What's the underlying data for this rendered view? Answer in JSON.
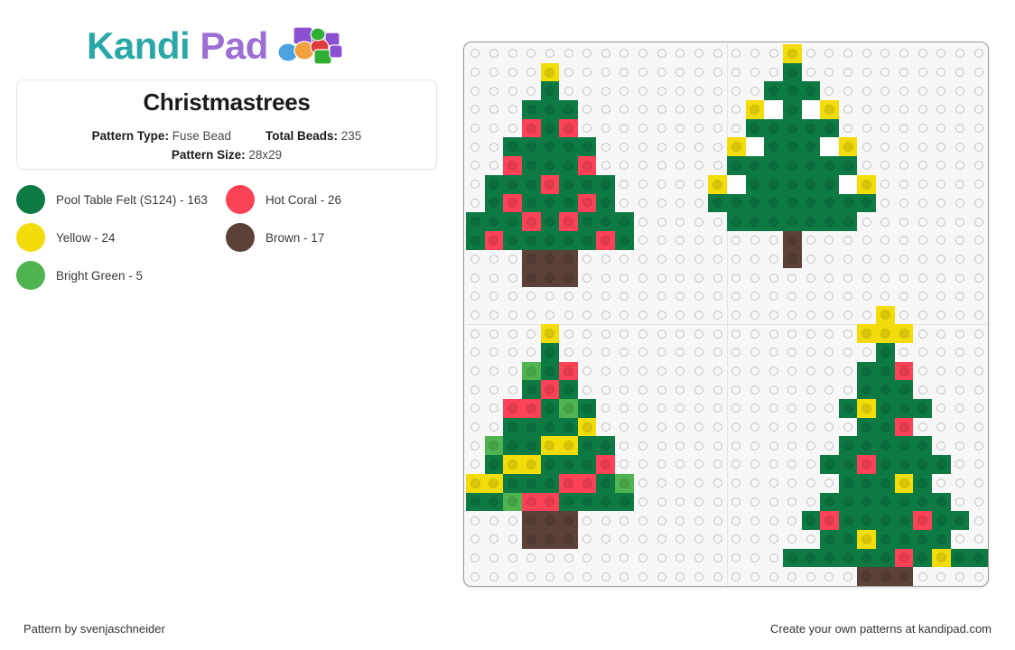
{
  "brand": {
    "name_part1": "Kandi",
    "name_part2": "Pad",
    "logo_icon": "kandi-beads-icon",
    "color_teal": "#2aa8a8",
    "color_purple": "#9b6fd4"
  },
  "card": {
    "title": "Christmastrees",
    "pattern_type_label": "Pattern Type:",
    "pattern_type_value": "Fuse Bead",
    "total_beads_label": "Total Beads:",
    "total_beads_value": "235",
    "pattern_size_label": "Pattern Size:",
    "pattern_size_value": "28x29"
  },
  "legend": {
    "items": [
      {
        "label": "Pool Table Felt (S124) - 163",
        "color": "#0d7a43",
        "name": "Pool Table Felt (S124)",
        "count": 163,
        "key": "G"
      },
      {
        "label": "Hot Coral - 26",
        "color": "#fb4256",
        "name": "Hot Coral",
        "count": 26,
        "key": "C"
      },
      {
        "label": "Yellow - 24",
        "color": "#f2dc0a",
        "name": "Yellow",
        "count": 24,
        "key": "Y"
      },
      {
        "label": "Brown - 17",
        "color": "#5b4137",
        "name": "Brown",
        "count": 17,
        "key": "N"
      },
      {
        "label": "Bright Green - 5",
        "color": "#4fb34f",
        "name": "Bright Green",
        "count": 5,
        "key": "L"
      }
    ]
  },
  "board": {
    "cols": 28,
    "rows": 29,
    "peg_color": "#c4c4c4",
    "board_color": "#f7f7f7",
    "palette": {
      "G": "#0d7a43",
      "C": "#fb4256",
      "Y": "#f2dc0a",
      "N": "#5b4137",
      "L": "#4fb34f",
      "W": "#ffffff",
      ".": null
    },
    "rows_data": [
      "................................................................",
      "....Y................Y......",
      "....G................G......",
      "...GGG..............GGG.....",
      "...CGC.............YWGWY....",
      "..GGGGG............GGGGG....",
      "..CGGGC...........YWGGGWY...",
      ".GGGCGGG..........GGGGGGGG..",
      ".GCGGGCG.........YWGGGGGGWY.",
      "GGGCGCGGG........GGGGGGGGGG.",
      "GCGGGGGCG.........GGGGGGGGG.",
      "...NNN.............N........",
      "...NNN.............N........",
      "............................",
      "............................",
      "....Y....................Y..",
      "....G...................YYY.",
      "...LGC...................G..",
      "...GCG..................GGC.",
      "..CCGLG.................GGGG",
      "..GGGGY................GGYGGG",
      ".LGGYYGG................GGGC",
      ".GYYGGGC...............GGGGGG",
      "YYGGGCCGL.............GGCGGGGG",
      "GGLCCGGGG..............GGGYGG",
      "...NNN...............GGGGGGGG",
      "...NNN..............GGGGGCGYGG",
      ".....................NNN....",
      "............................"
    ]
  },
  "grid_cells": {
    "comment": "explicit sparse bead placements as [row, col, colorKey]",
    "placements": [
      [
        1,
        4,
        "Y"
      ],
      [
        2,
        4,
        "G"
      ],
      [
        3,
        3,
        "G"
      ],
      [
        3,
        4,
        "G"
      ],
      [
        3,
        5,
        "G"
      ],
      [
        4,
        3,
        "C"
      ],
      [
        4,
        4,
        "G"
      ],
      [
        4,
        5,
        "C"
      ],
      [
        5,
        2,
        "G"
      ],
      [
        5,
        3,
        "G"
      ],
      [
        5,
        4,
        "G"
      ],
      [
        5,
        5,
        "G"
      ],
      [
        5,
        6,
        "G"
      ],
      [
        6,
        2,
        "C"
      ],
      [
        6,
        3,
        "G"
      ],
      [
        6,
        4,
        "G"
      ],
      [
        6,
        5,
        "G"
      ],
      [
        6,
        6,
        "C"
      ],
      [
        7,
        1,
        "G"
      ],
      [
        7,
        2,
        "G"
      ],
      [
        7,
        3,
        "G"
      ],
      [
        7,
        4,
        "C"
      ],
      [
        7,
        5,
        "G"
      ],
      [
        7,
        6,
        "G"
      ],
      [
        7,
        7,
        "G"
      ],
      [
        8,
        1,
        "G"
      ],
      [
        8,
        2,
        "C"
      ],
      [
        8,
        3,
        "G"
      ],
      [
        8,
        4,
        "G"
      ],
      [
        8,
        5,
        "G"
      ],
      [
        8,
        6,
        "C"
      ],
      [
        8,
        7,
        "G"
      ],
      [
        9,
        0,
        "G"
      ],
      [
        9,
        1,
        "G"
      ],
      [
        9,
        2,
        "G"
      ],
      [
        9,
        3,
        "C"
      ],
      [
        9,
        4,
        "G"
      ],
      [
        9,
        5,
        "C"
      ],
      [
        9,
        6,
        "G"
      ],
      [
        9,
        7,
        "G"
      ],
      [
        9,
        8,
        "G"
      ],
      [
        10,
        0,
        "G"
      ],
      [
        10,
        1,
        "C"
      ],
      [
        10,
        2,
        "G"
      ],
      [
        10,
        3,
        "G"
      ],
      [
        10,
        4,
        "G"
      ],
      [
        10,
        5,
        "G"
      ],
      [
        10,
        6,
        "G"
      ],
      [
        10,
        7,
        "C"
      ],
      [
        10,
        8,
        "G"
      ],
      [
        11,
        3,
        "N"
      ],
      [
        11,
        4,
        "N"
      ],
      [
        11,
        5,
        "N"
      ],
      [
        12,
        3,
        "N"
      ],
      [
        12,
        4,
        "N"
      ],
      [
        12,
        5,
        "N"
      ],
      [
        0,
        17,
        "Y"
      ],
      [
        1,
        17,
        "G"
      ],
      [
        2,
        16,
        "G"
      ],
      [
        2,
        17,
        "G"
      ],
      [
        2,
        18,
        "G"
      ],
      [
        3,
        15,
        "Y"
      ],
      [
        3,
        16,
        "W"
      ],
      [
        3,
        17,
        "G"
      ],
      [
        3,
        18,
        "W"
      ],
      [
        3,
        19,
        "Y"
      ],
      [
        4,
        15,
        "G"
      ],
      [
        4,
        16,
        "G"
      ],
      [
        4,
        17,
        "G"
      ],
      [
        4,
        18,
        "G"
      ],
      [
        4,
        19,
        "G"
      ],
      [
        5,
        14,
        "Y"
      ],
      [
        5,
        15,
        "W"
      ],
      [
        5,
        16,
        "G"
      ],
      [
        5,
        17,
        "G"
      ],
      [
        5,
        18,
        "G"
      ],
      [
        5,
        19,
        "W"
      ],
      [
        5,
        20,
        "Y"
      ],
      [
        6,
        14,
        "G"
      ],
      [
        6,
        15,
        "G"
      ],
      [
        6,
        16,
        "G"
      ],
      [
        6,
        17,
        "G"
      ],
      [
        6,
        18,
        "G"
      ],
      [
        6,
        19,
        "G"
      ],
      [
        6,
        20,
        "G"
      ],
      [
        7,
        13,
        "Y"
      ],
      [
        7,
        14,
        "W"
      ],
      [
        7,
        15,
        "G"
      ],
      [
        7,
        16,
        "G"
      ],
      [
        7,
        17,
        "G"
      ],
      [
        7,
        18,
        "G"
      ],
      [
        7,
        19,
        "G"
      ],
      [
        7,
        20,
        "W"
      ],
      [
        7,
        21,
        "Y"
      ],
      [
        8,
        13,
        "G"
      ],
      [
        8,
        14,
        "G"
      ],
      [
        8,
        15,
        "G"
      ],
      [
        8,
        16,
        "G"
      ],
      [
        8,
        17,
        "G"
      ],
      [
        8,
        18,
        "G"
      ],
      [
        8,
        19,
        "G"
      ],
      [
        8,
        20,
        "G"
      ],
      [
        8,
        21,
        "G"
      ],
      [
        9,
        14,
        "G"
      ],
      [
        9,
        15,
        "G"
      ],
      [
        9,
        16,
        "G"
      ],
      [
        9,
        17,
        "G"
      ],
      [
        9,
        18,
        "G"
      ],
      [
        9,
        19,
        "G"
      ],
      [
        9,
        20,
        "G"
      ],
      [
        10,
        17,
        "N"
      ],
      [
        11,
        17,
        "N"
      ],
      [
        15,
        4,
        "Y"
      ],
      [
        16,
        4,
        "G"
      ],
      [
        17,
        3,
        "L"
      ],
      [
        17,
        4,
        "G"
      ],
      [
        17,
        5,
        "C"
      ],
      [
        18,
        3,
        "G"
      ],
      [
        18,
        4,
        "C"
      ],
      [
        18,
        5,
        "G"
      ],
      [
        19,
        2,
        "C"
      ],
      [
        19,
        3,
        "C"
      ],
      [
        19,
        4,
        "G"
      ],
      [
        19,
        5,
        "L"
      ],
      [
        19,
        6,
        "G"
      ],
      [
        20,
        2,
        "G"
      ],
      [
        20,
        3,
        "G"
      ],
      [
        20,
        4,
        "G"
      ],
      [
        20,
        5,
        "G"
      ],
      [
        20,
        6,
        "Y"
      ],
      [
        21,
        1,
        "L"
      ],
      [
        21,
        2,
        "G"
      ],
      [
        21,
        3,
        "G"
      ],
      [
        21,
        4,
        "Y"
      ],
      [
        21,
        5,
        "Y"
      ],
      [
        21,
        6,
        "G"
      ],
      [
        21,
        7,
        "G"
      ],
      [
        22,
        1,
        "G"
      ],
      [
        22,
        2,
        "Y"
      ],
      [
        22,
        3,
        "Y"
      ],
      [
        22,
        4,
        "G"
      ],
      [
        22,
        5,
        "G"
      ],
      [
        22,
        6,
        "G"
      ],
      [
        22,
        7,
        "C"
      ],
      [
        23,
        0,
        "Y"
      ],
      [
        23,
        1,
        "Y"
      ],
      [
        23,
        2,
        "G"
      ],
      [
        23,
        3,
        "G"
      ],
      [
        23,
        4,
        "G"
      ],
      [
        23,
        5,
        "C"
      ],
      [
        23,
        6,
        "C"
      ],
      [
        23,
        7,
        "G"
      ],
      [
        23,
        8,
        "L"
      ],
      [
        24,
        0,
        "G"
      ],
      [
        24,
        1,
        "G"
      ],
      [
        24,
        2,
        "L"
      ],
      [
        24,
        3,
        "C"
      ],
      [
        24,
        4,
        "C"
      ],
      [
        24,
        5,
        "G"
      ],
      [
        24,
        6,
        "G"
      ],
      [
        24,
        7,
        "G"
      ],
      [
        24,
        8,
        "G"
      ],
      [
        25,
        3,
        "N"
      ],
      [
        25,
        4,
        "N"
      ],
      [
        25,
        5,
        "N"
      ],
      [
        26,
        3,
        "N"
      ],
      [
        26,
        4,
        "N"
      ],
      [
        26,
        5,
        "N"
      ],
      [
        14,
        22,
        "Y"
      ],
      [
        15,
        21,
        "Y"
      ],
      [
        15,
        22,
        "Y"
      ],
      [
        15,
        23,
        "Y"
      ],
      [
        16,
        22,
        "G"
      ],
      [
        17,
        21,
        "G"
      ],
      [
        17,
        22,
        "G"
      ],
      [
        17,
        23,
        "C"
      ],
      [
        18,
        21,
        "G"
      ],
      [
        18,
        22,
        "G"
      ],
      [
        18,
        23,
        "G"
      ],
      [
        19,
        20,
        "G"
      ],
      [
        19,
        21,
        "Y"
      ],
      [
        19,
        22,
        "G"
      ],
      [
        19,
        23,
        "G"
      ],
      [
        19,
        24,
        "G"
      ],
      [
        20,
        21,
        "G"
      ],
      [
        20,
        22,
        "G"
      ],
      [
        20,
        23,
        "C"
      ],
      [
        21,
        20,
        "G"
      ],
      [
        21,
        21,
        "G"
      ],
      [
        21,
        22,
        "G"
      ],
      [
        21,
        23,
        "G"
      ],
      [
        21,
        24,
        "G"
      ],
      [
        22,
        19,
        "G"
      ],
      [
        22,
        20,
        "G"
      ],
      [
        22,
        21,
        "C"
      ],
      [
        22,
        22,
        "G"
      ],
      [
        22,
        23,
        "G"
      ],
      [
        22,
        24,
        "G"
      ],
      [
        22,
        25,
        "G"
      ],
      [
        23,
        20,
        "G"
      ],
      [
        23,
        21,
        "G"
      ],
      [
        23,
        22,
        "G"
      ],
      [
        23,
        23,
        "Y"
      ],
      [
        23,
        24,
        "G"
      ],
      [
        24,
        19,
        "G"
      ],
      [
        24,
        20,
        "G"
      ],
      [
        24,
        21,
        "G"
      ],
      [
        24,
        22,
        "G"
      ],
      [
        24,
        23,
        "G"
      ],
      [
        24,
        24,
        "G"
      ],
      [
        24,
        25,
        "G"
      ],
      [
        25,
        18,
        "G"
      ],
      [
        25,
        19,
        "C"
      ],
      [
        25,
        20,
        "G"
      ],
      [
        25,
        21,
        "G"
      ],
      [
        25,
        22,
        "G"
      ],
      [
        25,
        23,
        "G"
      ],
      [
        25,
        24,
        "C"
      ],
      [
        25,
        25,
        "G"
      ],
      [
        25,
        26,
        "G"
      ],
      [
        26,
        19,
        "G"
      ],
      [
        26,
        20,
        "G"
      ],
      [
        26,
        21,
        "Y"
      ],
      [
        26,
        22,
        "G"
      ],
      [
        26,
        23,
        "G"
      ],
      [
        26,
        24,
        "G"
      ],
      [
        26,
        25,
        "G"
      ],
      [
        27,
        17,
        "G"
      ],
      [
        27,
        18,
        "G"
      ],
      [
        27,
        19,
        "G"
      ],
      [
        27,
        20,
        "G"
      ],
      [
        27,
        21,
        "G"
      ],
      [
        27,
        22,
        "G"
      ],
      [
        27,
        23,
        "C"
      ],
      [
        27,
        24,
        "G"
      ],
      [
        27,
        25,
        "Y"
      ],
      [
        27,
        26,
        "G"
      ],
      [
        27,
        27,
        "G"
      ],
      [
        28,
        21,
        "N"
      ],
      [
        28,
        22,
        "N"
      ],
      [
        28,
        23,
        "N"
      ]
    ]
  },
  "footer": {
    "left": "Pattern by svenjaschneider",
    "right": "Create your own patterns at kandipad.com"
  }
}
